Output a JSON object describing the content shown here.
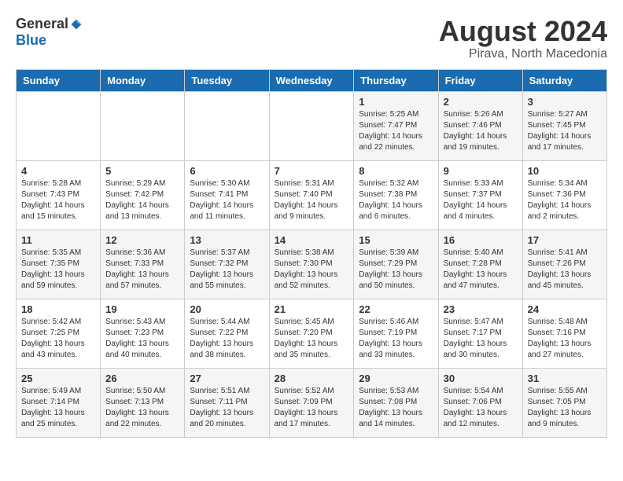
{
  "header": {
    "logo_general": "General",
    "logo_blue": "Blue",
    "month_year": "August 2024",
    "location": "Pirava, North Macedonia"
  },
  "weekdays": [
    "Sunday",
    "Monday",
    "Tuesday",
    "Wednesday",
    "Thursday",
    "Friday",
    "Saturday"
  ],
  "weeks": [
    [
      {
        "day": "",
        "info": ""
      },
      {
        "day": "",
        "info": ""
      },
      {
        "day": "",
        "info": ""
      },
      {
        "day": "",
        "info": ""
      },
      {
        "day": "1",
        "info": "Sunrise: 5:25 AM\nSunset: 7:47 PM\nDaylight: 14 hours\nand 22 minutes."
      },
      {
        "day": "2",
        "info": "Sunrise: 5:26 AM\nSunset: 7:46 PM\nDaylight: 14 hours\nand 19 minutes."
      },
      {
        "day": "3",
        "info": "Sunrise: 5:27 AM\nSunset: 7:45 PM\nDaylight: 14 hours\nand 17 minutes."
      }
    ],
    [
      {
        "day": "4",
        "info": "Sunrise: 5:28 AM\nSunset: 7:43 PM\nDaylight: 14 hours\nand 15 minutes."
      },
      {
        "day": "5",
        "info": "Sunrise: 5:29 AM\nSunset: 7:42 PM\nDaylight: 14 hours\nand 13 minutes."
      },
      {
        "day": "6",
        "info": "Sunrise: 5:30 AM\nSunset: 7:41 PM\nDaylight: 14 hours\nand 11 minutes."
      },
      {
        "day": "7",
        "info": "Sunrise: 5:31 AM\nSunset: 7:40 PM\nDaylight: 14 hours\nand 9 minutes."
      },
      {
        "day": "8",
        "info": "Sunrise: 5:32 AM\nSunset: 7:38 PM\nDaylight: 14 hours\nand 6 minutes."
      },
      {
        "day": "9",
        "info": "Sunrise: 5:33 AM\nSunset: 7:37 PM\nDaylight: 14 hours\nand 4 minutes."
      },
      {
        "day": "10",
        "info": "Sunrise: 5:34 AM\nSunset: 7:36 PM\nDaylight: 14 hours\nand 2 minutes."
      }
    ],
    [
      {
        "day": "11",
        "info": "Sunrise: 5:35 AM\nSunset: 7:35 PM\nDaylight: 13 hours\nand 59 minutes."
      },
      {
        "day": "12",
        "info": "Sunrise: 5:36 AM\nSunset: 7:33 PM\nDaylight: 13 hours\nand 57 minutes."
      },
      {
        "day": "13",
        "info": "Sunrise: 5:37 AM\nSunset: 7:32 PM\nDaylight: 13 hours\nand 55 minutes."
      },
      {
        "day": "14",
        "info": "Sunrise: 5:38 AM\nSunset: 7:30 PM\nDaylight: 13 hours\nand 52 minutes."
      },
      {
        "day": "15",
        "info": "Sunrise: 5:39 AM\nSunset: 7:29 PM\nDaylight: 13 hours\nand 50 minutes."
      },
      {
        "day": "16",
        "info": "Sunrise: 5:40 AM\nSunset: 7:28 PM\nDaylight: 13 hours\nand 47 minutes."
      },
      {
        "day": "17",
        "info": "Sunrise: 5:41 AM\nSunset: 7:26 PM\nDaylight: 13 hours\nand 45 minutes."
      }
    ],
    [
      {
        "day": "18",
        "info": "Sunrise: 5:42 AM\nSunset: 7:25 PM\nDaylight: 13 hours\nand 43 minutes."
      },
      {
        "day": "19",
        "info": "Sunrise: 5:43 AM\nSunset: 7:23 PM\nDaylight: 13 hours\nand 40 minutes."
      },
      {
        "day": "20",
        "info": "Sunrise: 5:44 AM\nSunset: 7:22 PM\nDaylight: 13 hours\nand 38 minutes."
      },
      {
        "day": "21",
        "info": "Sunrise: 5:45 AM\nSunset: 7:20 PM\nDaylight: 13 hours\nand 35 minutes."
      },
      {
        "day": "22",
        "info": "Sunrise: 5:46 AM\nSunset: 7:19 PM\nDaylight: 13 hours\nand 33 minutes."
      },
      {
        "day": "23",
        "info": "Sunrise: 5:47 AM\nSunset: 7:17 PM\nDaylight: 13 hours\nand 30 minutes."
      },
      {
        "day": "24",
        "info": "Sunrise: 5:48 AM\nSunset: 7:16 PM\nDaylight: 13 hours\nand 27 minutes."
      }
    ],
    [
      {
        "day": "25",
        "info": "Sunrise: 5:49 AM\nSunset: 7:14 PM\nDaylight: 13 hours\nand 25 minutes."
      },
      {
        "day": "26",
        "info": "Sunrise: 5:50 AM\nSunset: 7:13 PM\nDaylight: 13 hours\nand 22 minutes."
      },
      {
        "day": "27",
        "info": "Sunrise: 5:51 AM\nSunset: 7:11 PM\nDaylight: 13 hours\nand 20 minutes."
      },
      {
        "day": "28",
        "info": "Sunrise: 5:52 AM\nSunset: 7:09 PM\nDaylight: 13 hours\nand 17 minutes."
      },
      {
        "day": "29",
        "info": "Sunrise: 5:53 AM\nSunset: 7:08 PM\nDaylight: 13 hours\nand 14 minutes."
      },
      {
        "day": "30",
        "info": "Sunrise: 5:54 AM\nSunset: 7:06 PM\nDaylight: 13 hours\nand 12 minutes."
      },
      {
        "day": "31",
        "info": "Sunrise: 5:55 AM\nSunset: 7:05 PM\nDaylight: 13 hours\nand 9 minutes."
      }
    ]
  ]
}
